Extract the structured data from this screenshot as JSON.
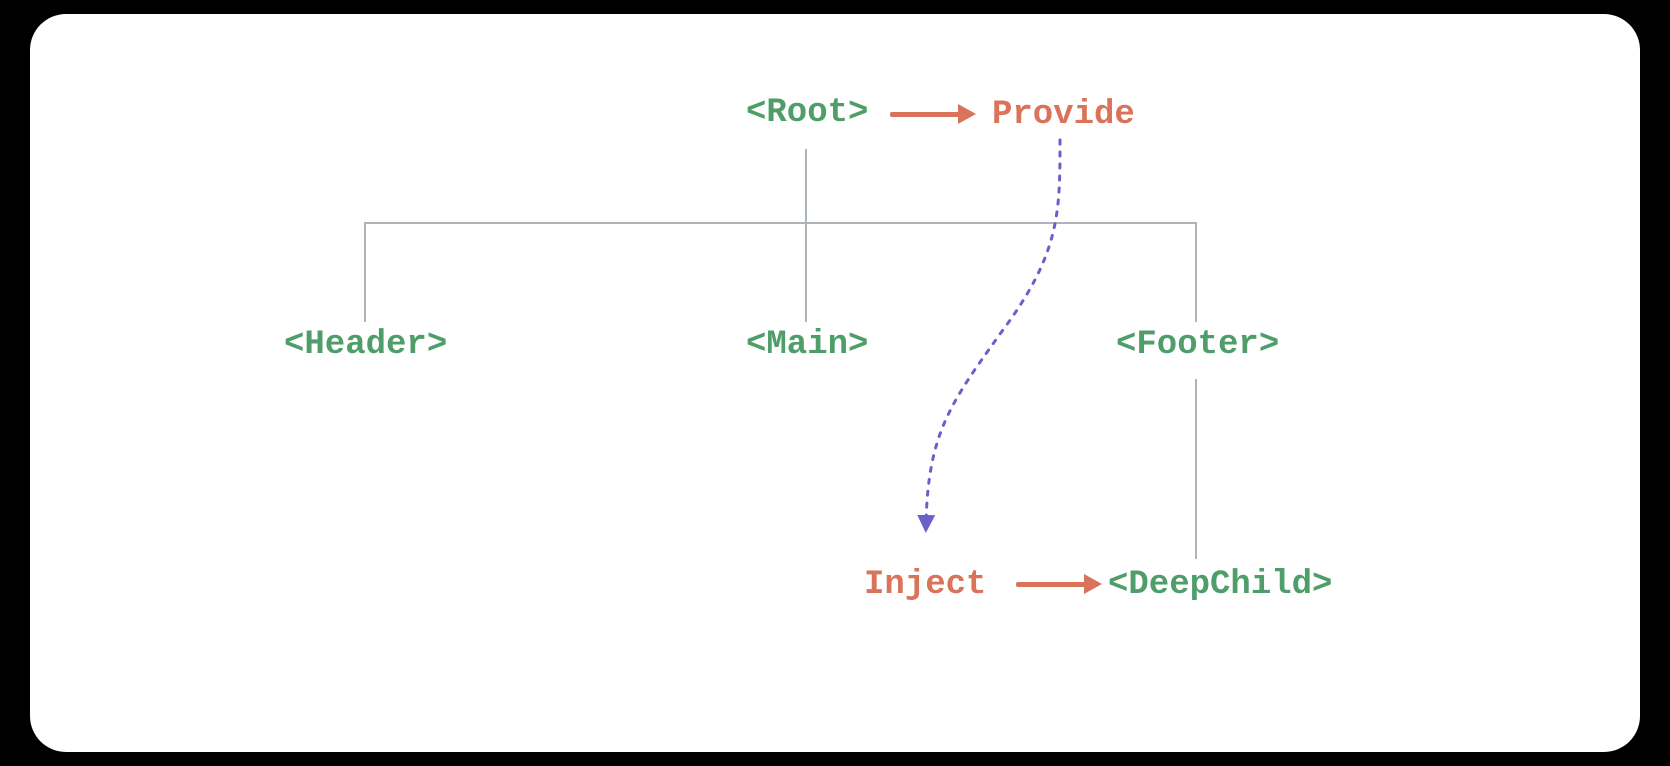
{
  "nodes": {
    "root": "<Root>",
    "header": "<Header>",
    "main": "<Main>",
    "footer": "<Footer>",
    "deepchild": "<DeepChild>"
  },
  "labels": {
    "provide": "Provide",
    "inject": "Inject"
  },
  "colors": {
    "component": "#4f9e6a",
    "action": "#d9735a",
    "tree_line": "#aeb4bb",
    "flow_curve": "#6b5fc9"
  }
}
